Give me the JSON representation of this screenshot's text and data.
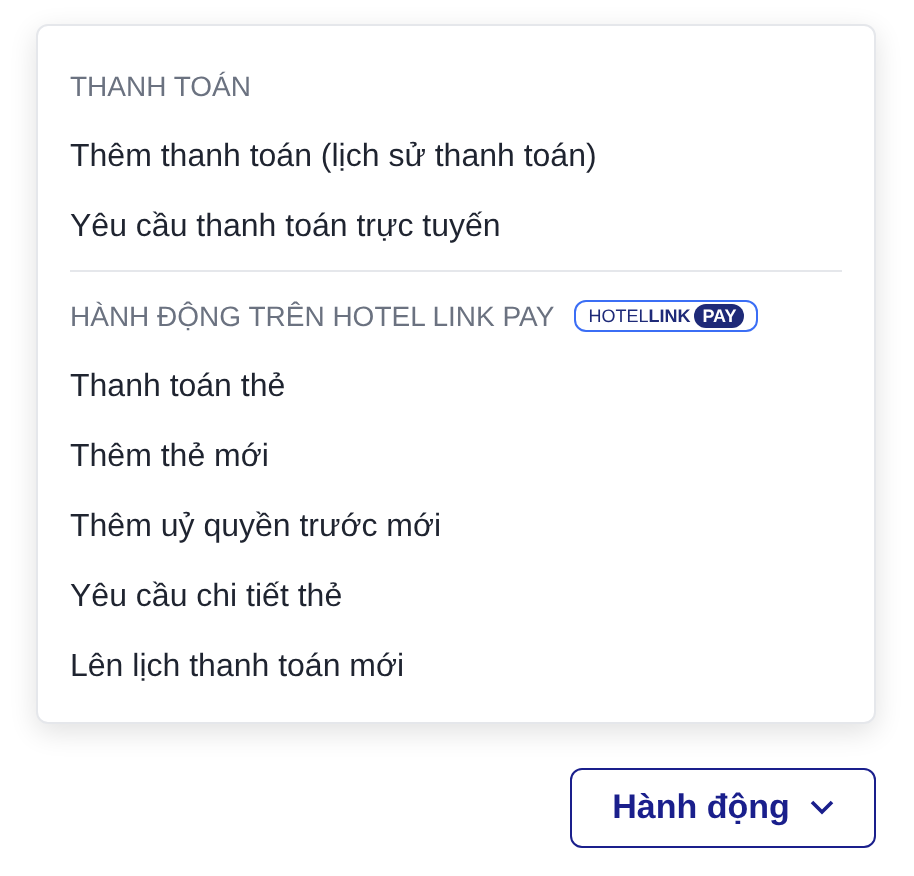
{
  "menu": {
    "sections": [
      {
        "heading": "THANH TOÁN",
        "items": [
          "Thêm thanh toán (lịch sử thanh toán)",
          "Yêu cầu thanh toán trực tuyến"
        ]
      },
      {
        "heading": "HÀNH ĐỘNG TRÊN HOTEL LINK PAY",
        "badge": {
          "brand": "HOTEL**LINK**",
          "tag": "PAY"
        },
        "items": [
          "Thanh toán thẻ",
          "Thêm thẻ mới",
          "Thêm uỷ quyền trước mới",
          "Yêu cầu chi tiết thẻ",
          "Lên lịch thanh toán mới"
        ]
      }
    ]
  },
  "button": {
    "label": "Hành động"
  }
}
